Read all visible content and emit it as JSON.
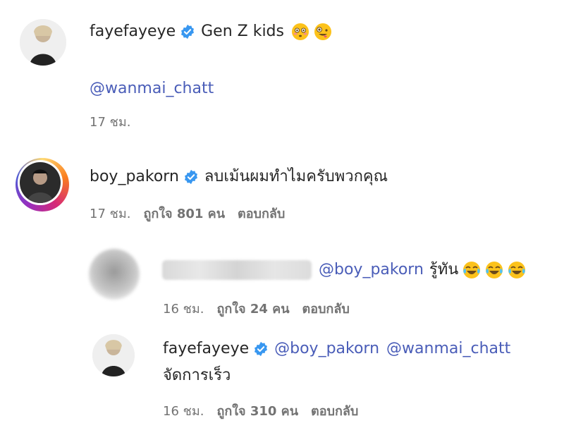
{
  "comments": [
    {
      "username": "fayefayeye",
      "verified": true,
      "text": "Gen Z kids",
      "emojis": [
        "flushed-face",
        "zany-face"
      ],
      "mention_line": "@wanmai_chatt",
      "time": "17 ชม."
    },
    {
      "username": "boy_pakorn",
      "verified": true,
      "text": "ลบเม้นผมทำไมครับพวกคุณ",
      "time": "17 ชม.",
      "likes": "ถูกใจ 801 คน",
      "reply": "ตอบกลับ"
    }
  ],
  "replies": [
    {
      "username_blurred": true,
      "mention": "@boy_pakorn",
      "text": "รู้ทัน",
      "emojis": [
        "tears-of-joy",
        "tears-of-joy",
        "tears-of-joy"
      ],
      "time": "16 ชม.",
      "likes": "ถูกใจ 24 คน",
      "reply": "ตอบกลับ"
    },
    {
      "username": "fayefayeye",
      "verified": true,
      "mention1": "@boy_pakorn",
      "mention2": "@wanmai_chatt",
      "text": "จัดการเร็ว",
      "time": "16 ชม.",
      "likes": "ถูกใจ 310 คน",
      "reply": "ตอบกลับ"
    }
  ],
  "colors": {
    "verified": "#3897f0",
    "mention": "#4a5db8",
    "meta": "#737373"
  }
}
